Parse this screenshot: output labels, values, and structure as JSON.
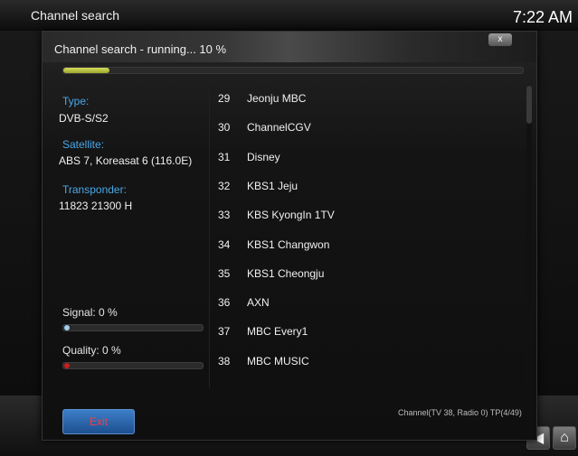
{
  "screen": {
    "title": "Channel search",
    "clock": "7:22 AM"
  },
  "dialog": {
    "title": "Channel search - running... 10 %",
    "close_label": "x",
    "progress_fraction": 0.1,
    "type_label": "Type:",
    "type_value": "DVB-S/S2",
    "satellite_label": "Satellite:",
    "satellite_value": "ABS 7, Koreasat 6 (116.0E)",
    "transponder_label": "Transponder:",
    "transponder_value": "11823 21300 H",
    "signal_label": "Signal: 0 %",
    "quality_label": "Quality: 0 %",
    "exit_label": "Exit",
    "status": "Channel(TV 38, Radio 0)  TP(4/49)",
    "channels": [
      {
        "num": "29",
        "name": "Jeonju MBC"
      },
      {
        "num": "30",
        "name": "ChannelCGV"
      },
      {
        "num": "31",
        "name": "Disney"
      },
      {
        "num": "32",
        "name": "KBS1 Jeju"
      },
      {
        "num": "33",
        "name": "KBS KyongIn 1TV"
      },
      {
        "num": "34",
        "name": "KBS1 Changwon"
      },
      {
        "num": "35",
        "name": "KBS1 Cheongju"
      },
      {
        "num": "36",
        "name": "AXN"
      },
      {
        "num": "37",
        "name": "MBC Every1"
      },
      {
        "num": "38",
        "name": "MBC MUSIC"
      }
    ]
  },
  "nav": {
    "back_icon": "back-arrow-icon",
    "home_icon": "home-icon"
  },
  "colors": {
    "accent": "#4aa8e8",
    "progress": "#c7d047",
    "exit_text": "#ff3b3b",
    "quality_dot": "#c81e1e",
    "signal_dot": "#9fd0f0"
  }
}
